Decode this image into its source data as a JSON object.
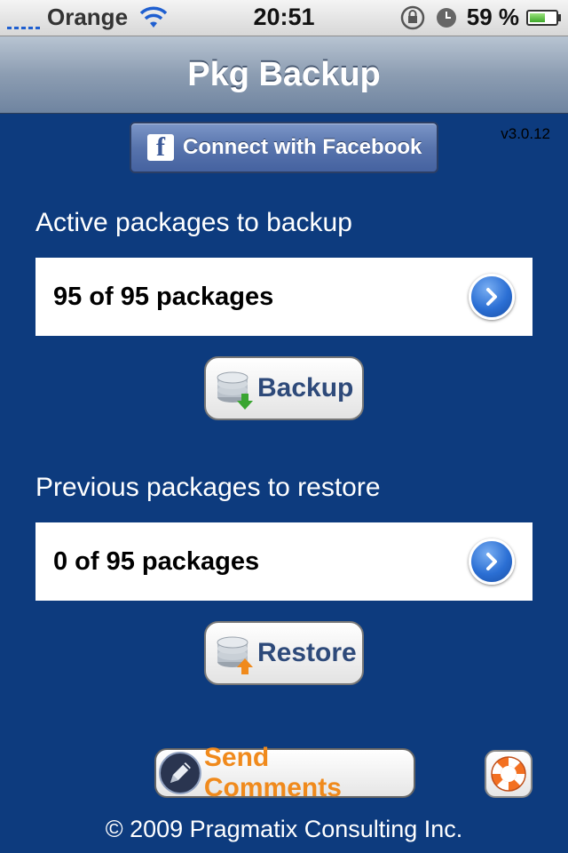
{
  "status_bar": {
    "carrier": "Orange",
    "time": "20:51",
    "battery_percent_label": "59 %",
    "battery_level": 0.59
  },
  "nav": {
    "title": "Pkg Backup"
  },
  "facebook": {
    "logo": "f",
    "label": "Connect with Facebook"
  },
  "version": "v3.0.12",
  "backup_section": {
    "label": "Active packages to backup",
    "summary": "95 of 95 packages",
    "button_label": "Backup"
  },
  "restore_section": {
    "label": "Previous packages to restore",
    "summary": "0 of 95 packages",
    "button_label": "Restore"
  },
  "send_comments_label": "Send Comments",
  "copyright": "© 2009 Pragmatix Consulting Inc.",
  "icons": {
    "signal": "signal-bars-icon",
    "wifi": "wifi-icon",
    "rotation_lock": "rotation-lock-icon",
    "alarm": "alarm-clock-icon",
    "battery": "battery-icon",
    "disclosure": "chevron-right-icon",
    "backup": "database-download-icon",
    "restore": "database-upload-icon",
    "comments": "pencil-icon",
    "help": "lifebuoy-icon"
  },
  "colors": {
    "background": "#0d3b7e",
    "facebook": "#5874ad",
    "send_comments": "#f08a1c",
    "action_text": "#2e4a7a"
  }
}
